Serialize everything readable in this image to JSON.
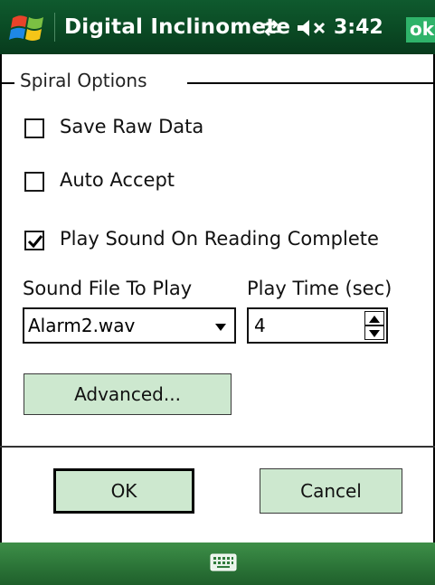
{
  "titlebar": {
    "title": "Digital Inclinomete",
    "time": "3:42",
    "ok_label": "ok",
    "icons": [
      "windows-start-icon",
      "connectivity-icon",
      "volume-muted-icon"
    ]
  },
  "group": {
    "title": "Spiral Options"
  },
  "options": [
    {
      "label": "Save Raw Data",
      "checked": false
    },
    {
      "label": "Auto Accept",
      "checked": false
    },
    {
      "label": "Play Sound On Reading Complete",
      "checked": true
    }
  ],
  "sound": {
    "file_label": "Sound File To Play",
    "file_value": "Alarm2.wav",
    "time_label": "Play Time (sec)",
    "time_value": "4"
  },
  "buttons": {
    "advanced": "Advanced...",
    "ok": "OK",
    "cancel": "Cancel"
  },
  "colors": {
    "title_bar": "#0a4a24",
    "button_fill": "#cde8cf",
    "ok_badge": "#2fb36a",
    "bottom_bar": "#2f7a3b"
  }
}
